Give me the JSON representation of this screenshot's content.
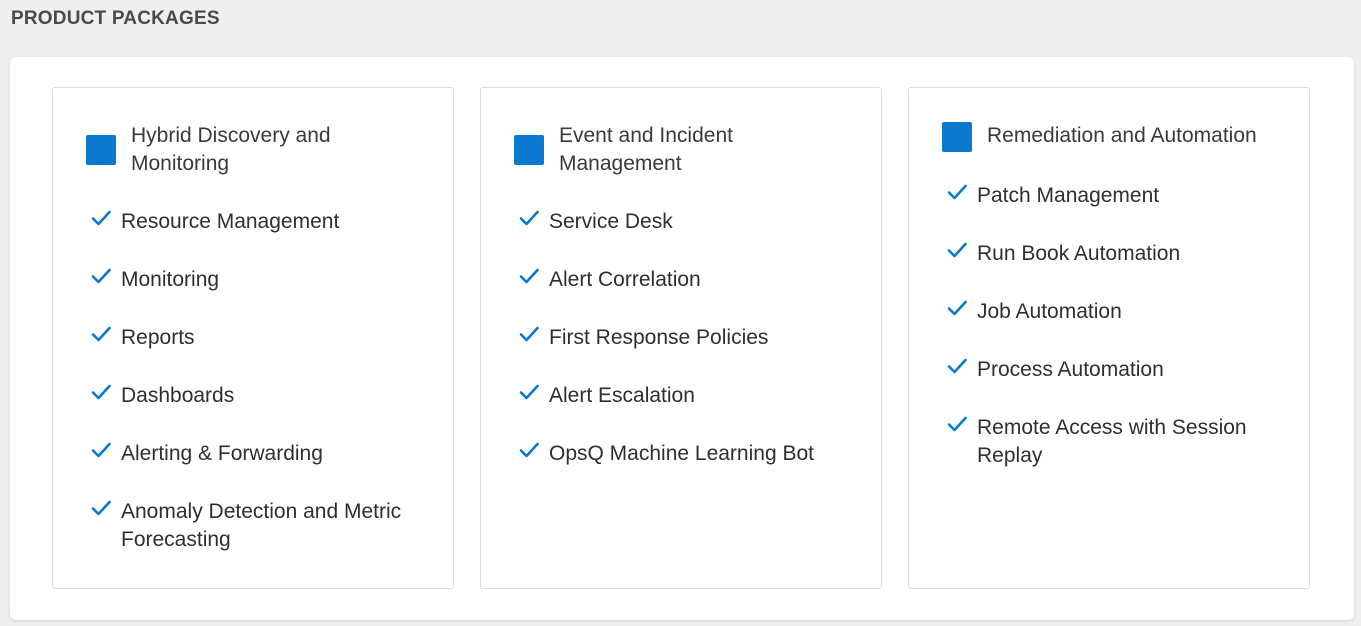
{
  "section": {
    "title": "PRODUCT PACKAGES"
  },
  "colors": {
    "accent": "#0a78cc",
    "check": "#0a78cc"
  },
  "packages": [
    {
      "title": "Hybrid Discovery and Monitoring",
      "icon": "check-icon",
      "features": [
        "Resource Management",
        "Monitoring",
        "Reports",
        "Dashboards",
        "Alerting & Forwarding",
        "Anomaly Detection and Metric Forecasting"
      ]
    },
    {
      "title": "Event and Incident Management",
      "icon": "check-icon",
      "features": [
        "Service Desk",
        "Alert Correlation",
        "First Response Policies",
        "Alert Escalation",
        "OpsQ Machine Learning Bot"
      ]
    },
    {
      "title": "Remediation and Automation",
      "icon": "check-icon",
      "features": [
        "Patch Management",
        "Run Book Automation",
        "Job Automation",
        "Process Automation",
        "Remote Access with Session Replay"
      ]
    }
  ]
}
